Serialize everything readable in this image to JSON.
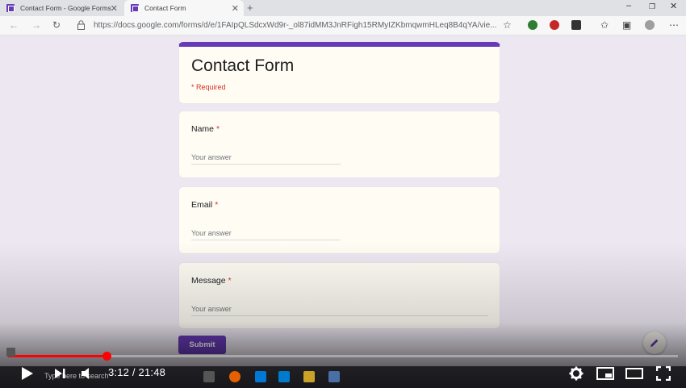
{
  "browser": {
    "tabs": [
      {
        "label": "Contact Form - Google Forms",
        "active": false
      },
      {
        "label": "Contact Form",
        "active": true
      }
    ],
    "url": "https://docs.google.com/forms/d/e/1FAIpQLSdcxWd9r-_ol87idMM3JnRFigh15RMyIZKbmqwmHLeq8B4qYA/vie..."
  },
  "form": {
    "title": "Contact Form",
    "required_note": "* Required",
    "questions": [
      {
        "label": "Name",
        "required_mark": "*",
        "placeholder": "Your answer"
      },
      {
        "label": "Email",
        "required_mark": "*",
        "placeholder": "Your answer"
      },
      {
        "label": "Message",
        "required_mark": "*",
        "placeholder": "Your answer"
      }
    ],
    "submit_label": "Submit"
  },
  "video": {
    "current_time": "3:12",
    "duration": "21:48",
    "time_display": "3:12 / 21:48",
    "progress_fraction": 0.147
  },
  "taskbar": {
    "search_text": "Type here to search"
  },
  "colors": {
    "accent": "#673ab7",
    "required": "#d93025",
    "progress": "#ff0000"
  }
}
